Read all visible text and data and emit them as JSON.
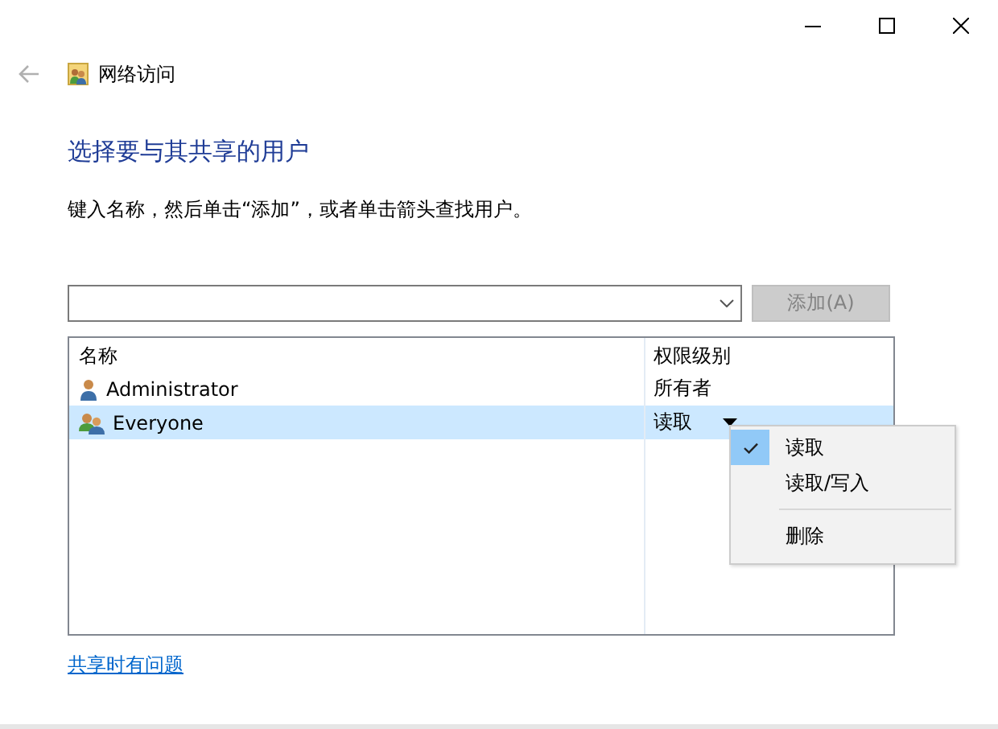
{
  "window": {
    "title": "网络访问"
  },
  "heading": "选择要与其共享的用户",
  "instruction": "键入名称，然后单击“添加”，或者单击箭头查找用户。",
  "add_button": {
    "label": "添加(A)",
    "disabled": true
  },
  "table": {
    "columns": [
      "名称",
      "权限级别"
    ],
    "rows": [
      {
        "kind": "user",
        "name": "Administrator",
        "permission": "所有者",
        "selected": false,
        "dropdown": false
      },
      {
        "kind": "group",
        "name": "Everyone",
        "permission": "读取",
        "selected": true,
        "dropdown": true
      }
    ]
  },
  "permission_menu": [
    {
      "kind": "item",
      "label": "读取",
      "checked": true
    },
    {
      "kind": "item",
      "label": "读取/写入",
      "checked": false
    },
    {
      "kind": "separator"
    },
    {
      "kind": "item",
      "label": "删除",
      "checked": false
    }
  ],
  "help_link": "共享时有问题"
}
